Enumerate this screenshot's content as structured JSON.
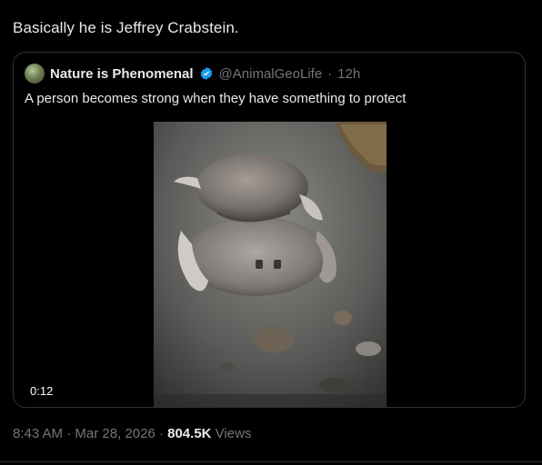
{
  "post": {
    "text": "Basically he is Jeffrey Crabstein.",
    "meta": {
      "time": "8:43 AM",
      "sep1": " · ",
      "date": "Mar 28, 2026",
      "sep2": " · ",
      "views_count": "804.5K",
      "views_label": " Views"
    }
  },
  "quote": {
    "author_name": "Nature is Phenomenal",
    "handle": "@AnimalGeoLife",
    "dot": "·",
    "age": "12h",
    "text": "A person becomes strong when they have something to protect",
    "video": {
      "duration": "0:12"
    }
  },
  "icons": {
    "verified": "verified-badge-icon",
    "avatar": "avatar"
  },
  "colors": {
    "background": "#000000",
    "text": "#e7e9ea",
    "muted": "#71767b",
    "border": "#2f3336",
    "verified": "#1d9bf0"
  }
}
